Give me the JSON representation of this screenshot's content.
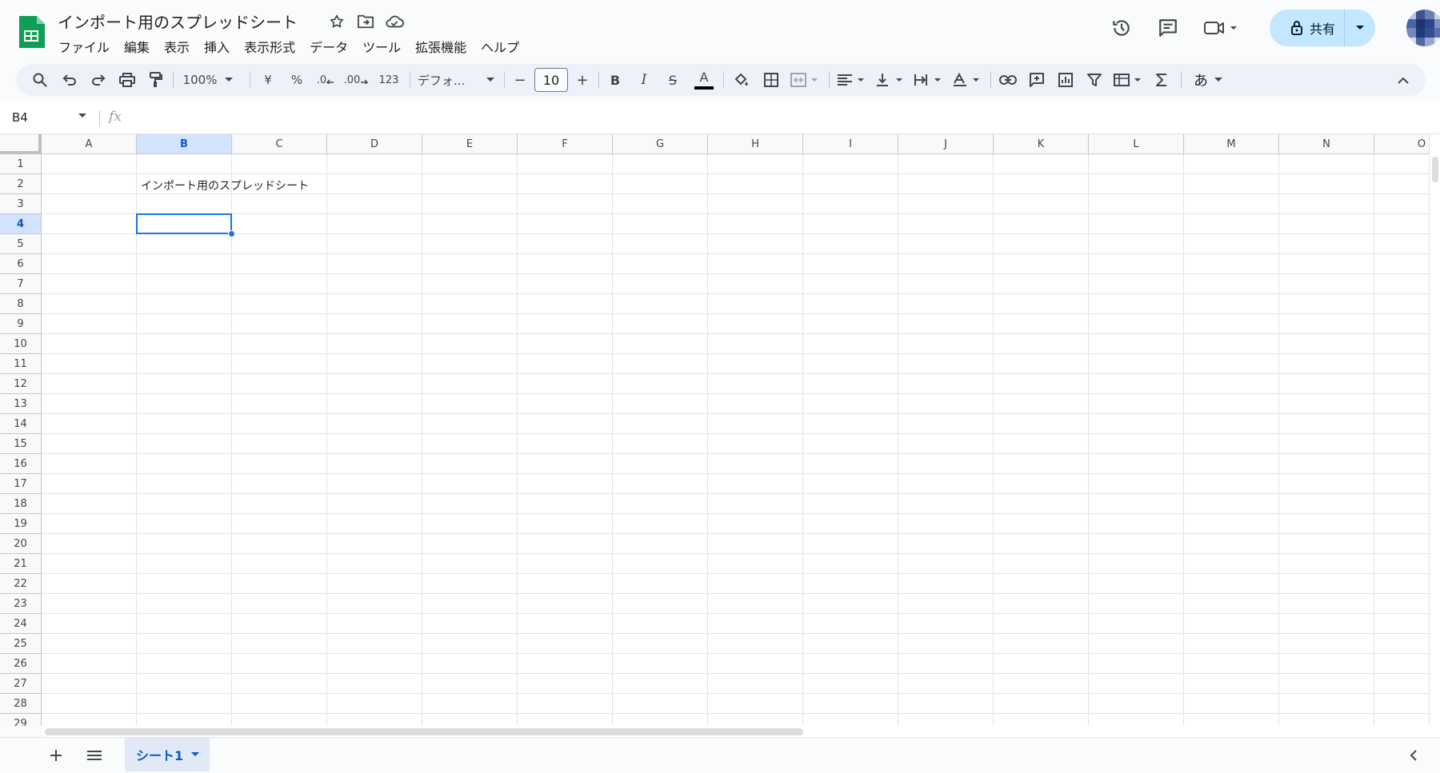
{
  "doc": {
    "title": "インポート用のスプレッドシート"
  },
  "menu": [
    "ファイル",
    "編集",
    "表示",
    "挿入",
    "表示形式",
    "データ",
    "ツール",
    "拡張機能",
    "ヘルプ"
  ],
  "share": {
    "label": "共有"
  },
  "toolbar": {
    "zoom": "100%",
    "currency": "¥",
    "percent": "%",
    "dec_decrease": ".0",
    "dec_increase": ".00",
    "number_format": "123",
    "font": "デフォ...",
    "font_size": "10",
    "minus": "−",
    "plus": "+",
    "bold": "B",
    "italic": "I",
    "strike": "S",
    "text_color": "A",
    "input_tool": "あ"
  },
  "formula_bar": {
    "name_box": "B4",
    "fx": "fx"
  },
  "grid": {
    "columns": [
      "A",
      "B",
      "C",
      "D",
      "E",
      "F",
      "G",
      "H",
      "I",
      "J",
      "K",
      "L",
      "M",
      "N",
      "O"
    ],
    "rows": [
      "1",
      "2",
      "3",
      "4",
      "5",
      "6",
      "7",
      "8",
      "9",
      "10",
      "11",
      "12",
      "13",
      "14",
      "15",
      "16",
      "17",
      "18",
      "19",
      "20",
      "21",
      "22",
      "23",
      "24",
      "25",
      "26",
      "27",
      "28",
      "29"
    ],
    "selected_column": "B",
    "selected_row": "4",
    "cells": [
      {
        "ref": "B2",
        "value": "インポート用のスプレッドシート"
      }
    ]
  },
  "sheets": [
    {
      "name": "シート1",
      "active": true
    }
  ],
  "colors": {
    "accent": "#1a73e8",
    "share_bg": "#c2e7ff",
    "toolbar_bg": "#edf2fa",
    "sheets_green": "#0f9d58",
    "selected_header": "#d3e3fd"
  }
}
